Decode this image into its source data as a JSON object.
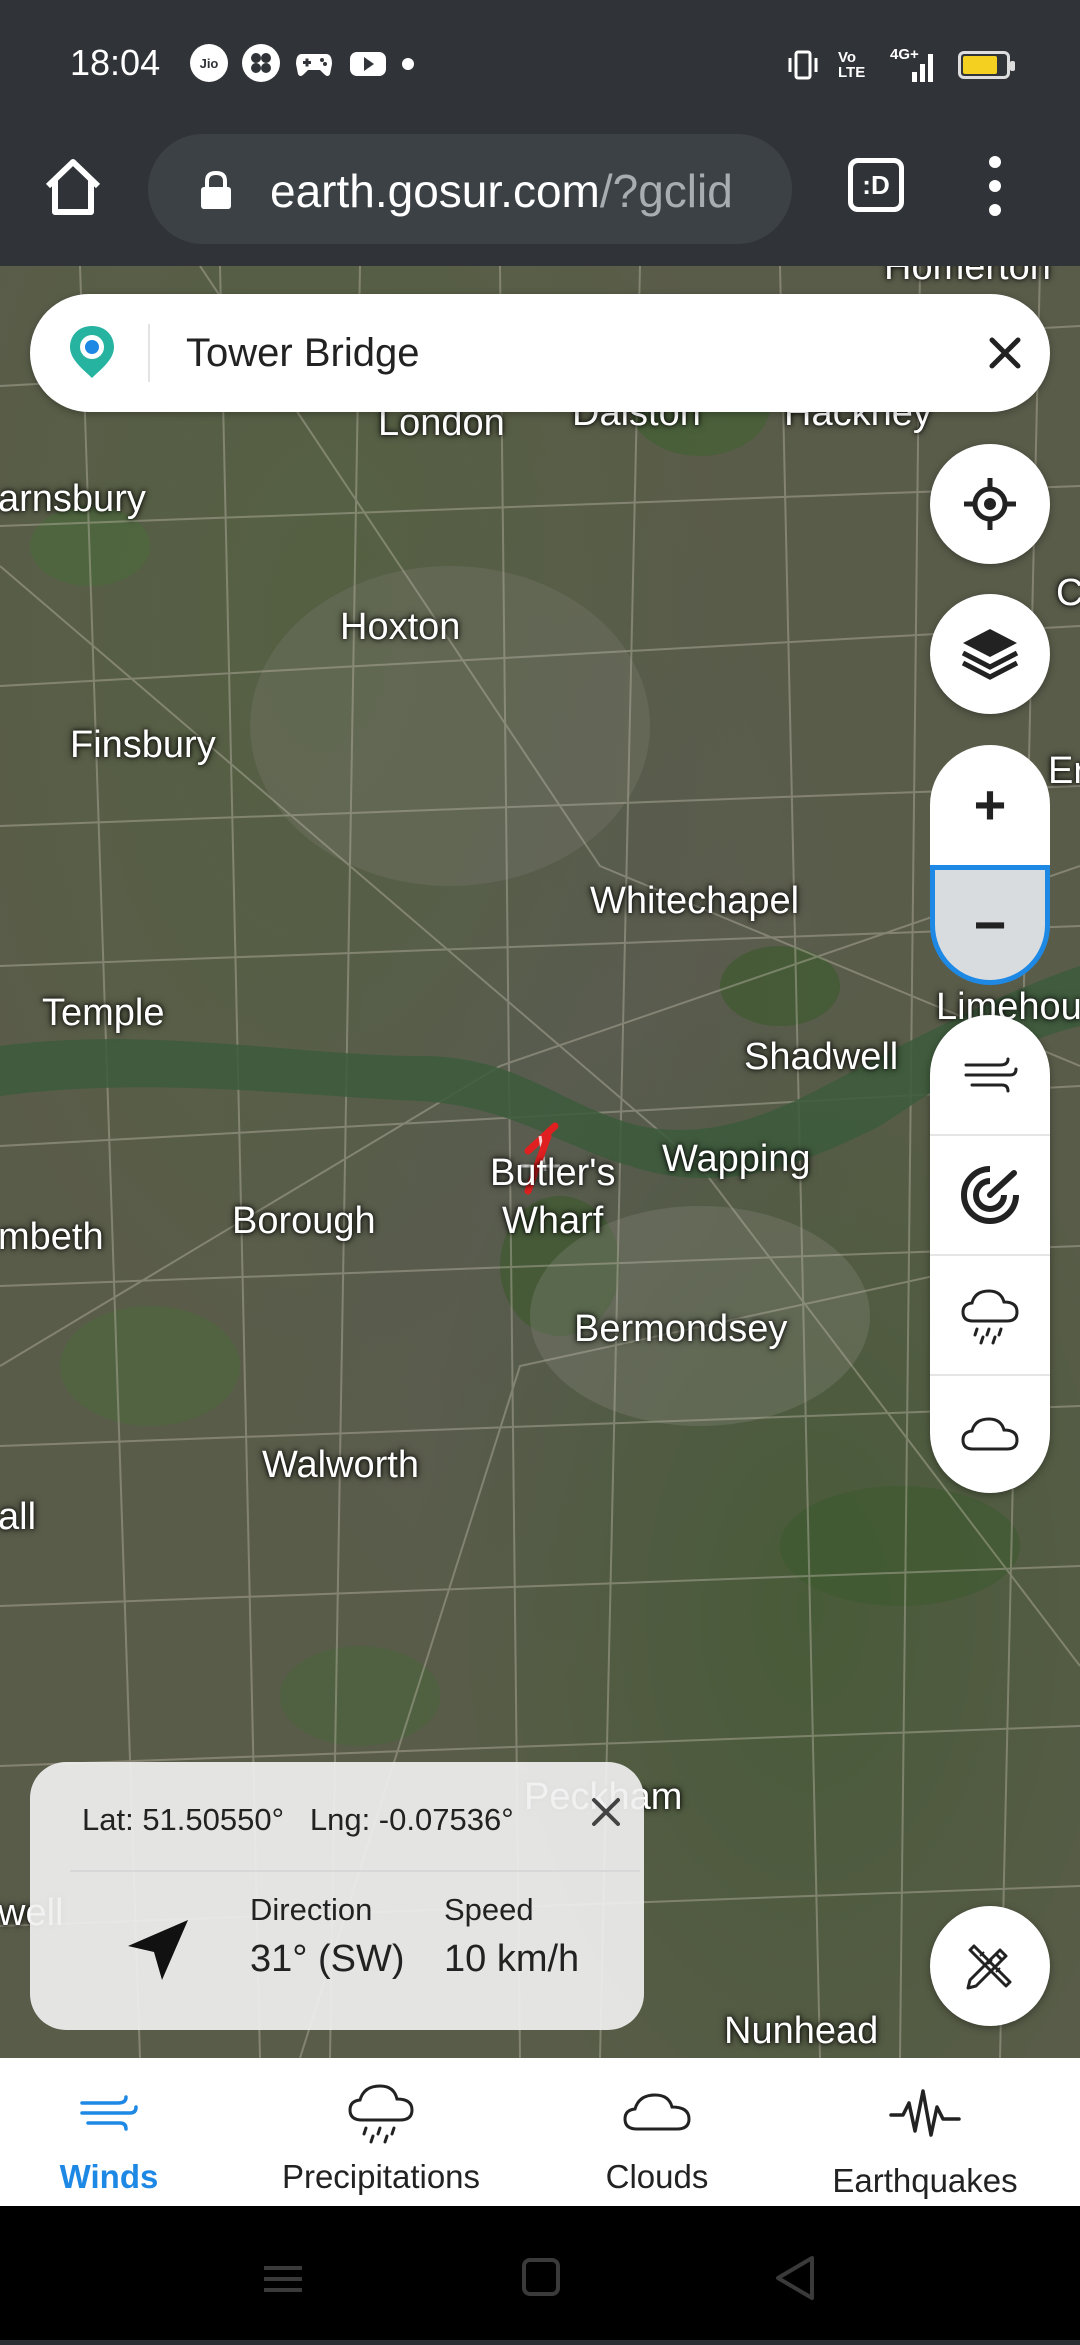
{
  "status_bar": {
    "time": "18:04",
    "left_icons": [
      "jio-icon",
      "app-icon",
      "gamepad-icon",
      "youtube-icon",
      "dot-icon"
    ],
    "jio_label": "Jio",
    "network_label": "4G+",
    "volte_label": "Vo LTE"
  },
  "browser": {
    "url_host": "earth.gosur.com",
    "url_path": "/?gclid",
    "tabs_label": ":D"
  },
  "search": {
    "value": "Tower Bridge",
    "placeholder": ""
  },
  "map": {
    "places": [
      {
        "label": "Homerton"
      },
      {
        "label": "London"
      },
      {
        "label": "Dalston"
      },
      {
        "label": "Hackney"
      },
      {
        "label": "arnsbury"
      },
      {
        "label": "Hoxton"
      },
      {
        "label": "Finsbury"
      },
      {
        "label": "Whitechapel"
      },
      {
        "label": "Temple"
      },
      {
        "label": "Limehou"
      },
      {
        "label": "Shadwell"
      },
      {
        "label": "Wapping"
      },
      {
        "label": "Butler's"
      },
      {
        "label": "Wharf"
      },
      {
        "label": "Borough"
      },
      {
        "label": "mbeth"
      },
      {
        "label": "Bermondsey"
      },
      {
        "label": "Walworth"
      },
      {
        "label": "all"
      },
      {
        "label": "Peckham"
      },
      {
        "label": "well"
      },
      {
        "label": "Nunhead"
      },
      {
        "label": "C"
      },
      {
        "label": "Er"
      }
    ]
  },
  "controls": {
    "locate": "target-icon",
    "layers": "layers-icon",
    "zoom_in": "+",
    "zoom_out": "−",
    "layer_buttons": [
      "wind-icon",
      "radar-icon",
      "rain-cloud-icon",
      "cloud-icon"
    ]
  },
  "info_card": {
    "lat_label": "Lat: 51.50550°",
    "lng_label": "Lng: -0.07536°",
    "direction_label": "Direction",
    "direction_value": "31° (SW)",
    "speed_label": "Speed",
    "speed_value": "10 km/h"
  },
  "bottom_nav": {
    "items": [
      {
        "label": "Winds",
        "icon": "wind-icon",
        "active": true
      },
      {
        "label": "Precipitations",
        "icon": "rain-cloud-icon",
        "active": false
      },
      {
        "label": "Clouds",
        "icon": "cloud-icon",
        "active": false
      },
      {
        "label": "Earthquakes",
        "icon": "seismograph-icon",
        "active": false
      }
    ]
  },
  "colors": {
    "accent": "#1e88e5",
    "brand_teal": "#26b3a0",
    "marker_red": "#e02020"
  }
}
